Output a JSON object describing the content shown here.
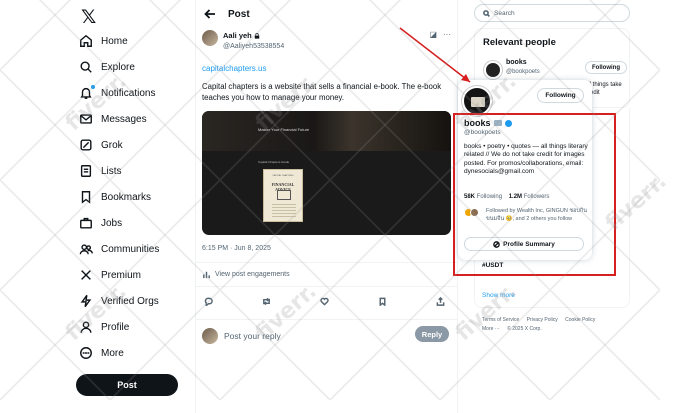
{
  "nav": {
    "logo": "𝕏",
    "items": [
      {
        "label": "Home",
        "icon": "home-icon"
      },
      {
        "label": "Explore",
        "icon": "search-icon"
      },
      {
        "label": "Notifications",
        "icon": "bell-icon"
      },
      {
        "label": "Messages",
        "icon": "mail-icon"
      },
      {
        "label": "Grok",
        "icon": "grok-icon"
      },
      {
        "label": "Lists",
        "icon": "list-icon"
      },
      {
        "label": "Bookmarks",
        "icon": "bookmark-icon"
      },
      {
        "label": "Jobs",
        "icon": "briefcase-icon"
      },
      {
        "label": "Communities",
        "icon": "people-icon"
      },
      {
        "label": "Premium",
        "icon": "x-logo-icon"
      },
      {
        "label": "Verified Orgs",
        "icon": "lightning-icon"
      },
      {
        "label": "Profile",
        "icon": "person-icon"
      },
      {
        "label": "More",
        "icon": "more-circle-icon"
      }
    ],
    "post_button": "Post"
  },
  "main": {
    "header_title": "Post",
    "author_name": "Aali yeh",
    "author_handle": "@Aaliyeh53538554",
    "link": "capitalchapters.us",
    "text": "Capital chapters is a website that sells a financial e-book. The e-book teaches you how to manage your money.",
    "media": {
      "banner_title": "Master Your Financial Future",
      "caption": "Capital Chapters Guide",
      "book_subtitle": "CAPITAL CHAPTERS",
      "book_title": "FINANCIAL ADVICE"
    },
    "timestamp": "6:15 PM · Jun 8, 2025",
    "engagements_label": "View post engagements",
    "reply_placeholder": "Post your reply",
    "reply_button": "Reply"
  },
  "right": {
    "search_placeholder": "Search",
    "relevant_title": "Relevant people",
    "relevant_name": "books",
    "relevant_handle": "@bookpoets",
    "relevant_follow": "Following",
    "relevant_bio": "all things take credit",
    "trend": "#USDT",
    "show_more": "Show more",
    "footer": [
      "Terms of Service",
      "Privacy Policy",
      "Cookie Policy",
      "More ···",
      "© 2025 X Corp."
    ]
  },
  "hovercard": {
    "name": "books",
    "handle": "@bookpoets",
    "follow_label": "Following",
    "bio": "books • poetry • quotes — all things literary related // We do not take credit for images posted. For promos/collaborations, email: dynesocials@gmail.com",
    "following_count": "58K",
    "following_label": "Following",
    "followers_count": "1.2M",
    "followers_label": "Followers",
    "followed_by": "Followed by Wealth Inc, GINGUN ชอบกินขนมจีน 🥺, and 2 others you follow",
    "summary_button": "Profile Summary"
  },
  "colors": {
    "accent": "#1d9bf0",
    "annotation": "#d62020",
    "text": "#0f1419",
    "muted": "#536471"
  },
  "watermark": "fiverr."
}
